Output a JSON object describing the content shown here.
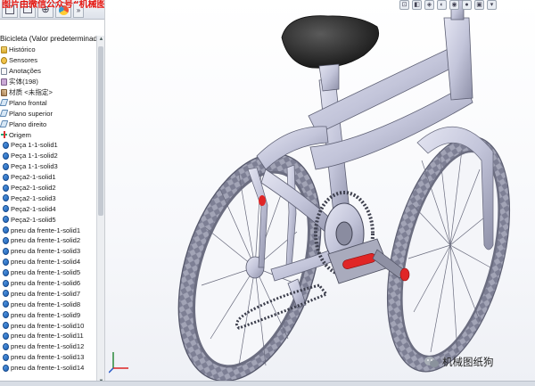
{
  "watermark_top": "图片由微信公众号“机械图纸狗”发布",
  "watermark_bottom": "机械图纸狗",
  "tree_root": "Bicicleta  (Valor predeterminado<<",
  "tree_items": [
    {
      "label": "Histórico",
      "icon": "history-icon"
    },
    {
      "label": "Sensores",
      "icon": "sensor-icon"
    },
    {
      "label": "Anotações",
      "icon": "annotation-icon"
    },
    {
      "label": "实体(198)",
      "icon": "solid-bodies-icon"
    },
    {
      "label": "材质 <未指定>",
      "icon": "material-icon"
    },
    {
      "label": "Plano frontal",
      "icon": "plane-icon"
    },
    {
      "label": "Plano superior",
      "icon": "plane-icon"
    },
    {
      "label": "Plano direito",
      "icon": "plane-icon"
    },
    {
      "label": "Origem",
      "icon": "origin-icon"
    },
    {
      "label": "Peça 1-1-solid1",
      "icon": "body-icon"
    },
    {
      "label": "Peça 1-1-solid2",
      "icon": "body-icon"
    },
    {
      "label": "Peça 1-1-solid3",
      "icon": "body-icon"
    },
    {
      "label": "Peça2-1-solid1",
      "icon": "body-icon"
    },
    {
      "label": "Peça2-1-solid2",
      "icon": "body-icon"
    },
    {
      "label": "Peça2-1-solid3",
      "icon": "body-icon"
    },
    {
      "label": "Peça2-1-solid4",
      "icon": "body-icon"
    },
    {
      "label": "Peça2-1-solid5",
      "icon": "body-icon"
    },
    {
      "label": "pneu da frente-1-solid1",
      "icon": "body-icon"
    },
    {
      "label": "pneu da frente-1-solid2",
      "icon": "body-icon"
    },
    {
      "label": "pneu da frente-1-solid3",
      "icon": "body-icon"
    },
    {
      "label": "pneu da frente-1-solid4",
      "icon": "body-icon"
    },
    {
      "label": "pneu da frente-1-solid5",
      "icon": "body-icon"
    },
    {
      "label": "pneu da frente-1-solid6",
      "icon": "body-icon"
    },
    {
      "label": "pneu da frente-1-solid7",
      "icon": "body-icon"
    },
    {
      "label": "pneu da frente-1-solid8",
      "icon": "body-icon"
    },
    {
      "label": "pneu da frente-1-solid9",
      "icon": "body-icon"
    },
    {
      "label": "pneu da frente-1-solid10",
      "icon": "body-icon"
    },
    {
      "label": "pneu da frente-1-solid11",
      "icon": "body-icon"
    },
    {
      "label": "pneu da frente-1-solid12",
      "icon": "body-icon"
    },
    {
      "label": "pneu da frente-1-solid13",
      "icon": "body-icon"
    },
    {
      "label": "pneu da frente-1-solid14",
      "icon": "body-icon"
    }
  ],
  "colors": {
    "frame": "#c9cbe0",
    "tire": "#9ea0b2",
    "saddle": "#2b2b2b",
    "pedal_reflector": "#e02626",
    "watermark_red": "#e3150f"
  }
}
